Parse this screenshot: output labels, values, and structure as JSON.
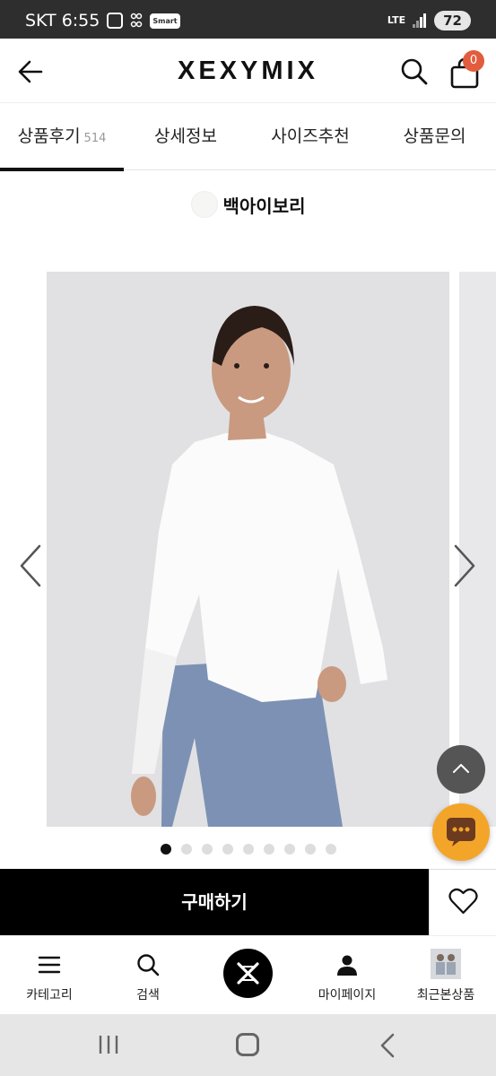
{
  "status_bar": {
    "carrier_time": "SKT 6:55",
    "smart_badge": "Smart",
    "network": "LTE",
    "battery": "72"
  },
  "header": {
    "logo": "XEXYMIX",
    "cart_count": "0"
  },
  "tabs": [
    {
      "label": "상품후기",
      "count": "514",
      "active": true
    },
    {
      "label": "상세정보",
      "active": false
    },
    {
      "label": "사이즈추천",
      "active": false
    },
    {
      "label": "상품문의",
      "active": false
    }
  ],
  "product": {
    "color_name": "백아이보리",
    "image_count": 9,
    "active_image": 0
  },
  "buy": {
    "label": "구매하기"
  },
  "bottom_nav": [
    {
      "label": "카테고리",
      "icon": "menu-icon"
    },
    {
      "label": "검색",
      "icon": "search-icon"
    },
    {
      "label": "",
      "icon": "home-logo-icon"
    },
    {
      "label": "마이페이지",
      "icon": "person-icon"
    },
    {
      "label": "최근본상품",
      "icon": "recent-product-thumbnail"
    }
  ],
  "colors": {
    "accent_badge": "#e25d3e",
    "chat_button": "#f3a52a",
    "buy_button": "#000000"
  }
}
